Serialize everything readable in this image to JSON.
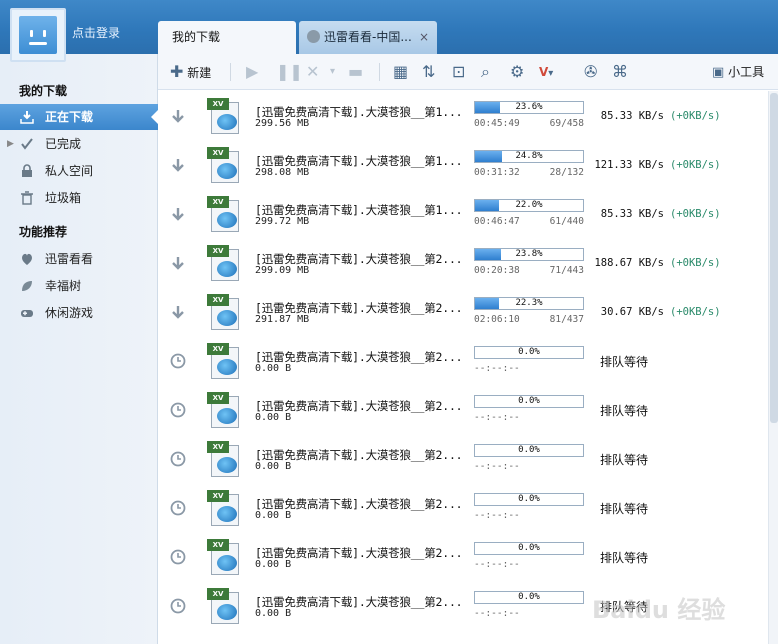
{
  "header": {
    "login_label": "点击登录",
    "tabs": [
      {
        "label": "我的下载",
        "active": true
      },
      {
        "label": "迅雷看看-中国...",
        "active": false,
        "close": "×"
      }
    ]
  },
  "toolbar": {
    "new_label": "新建",
    "tools_label": "小工具"
  },
  "sidebar": {
    "section_downloads": "我的下载",
    "items": [
      {
        "label": "正在下载",
        "icon": "download-icon",
        "selected": true
      },
      {
        "label": "已完成",
        "icon": "checkmark-icon",
        "selected": false
      },
      {
        "label": "私人空间",
        "icon": "lock-icon",
        "selected": false
      },
      {
        "label": "垃圾箱",
        "icon": "trash-icon",
        "selected": false
      }
    ],
    "section_features": "功能推荐",
    "features": [
      {
        "label": "迅雷看看",
        "icon": "xunlei-kankan-icon"
      },
      {
        "label": "幸福树",
        "icon": "leaf-icon"
      },
      {
        "label": "休闲游戏",
        "icon": "gamepad-icon"
      }
    ]
  },
  "downloads": [
    {
      "state": "downloading",
      "name": "[迅雷免费高清下载].大漠苍狼__第1...",
      "size": "299.56 MB",
      "progress": 23.6,
      "progress_label": "23.6%",
      "time": "00:45:49",
      "pieces": "69/458",
      "speed": "85.33 KB/s",
      "upload": "(+0KB/s)"
    },
    {
      "state": "downloading",
      "name": "[迅雷免费高清下载].大漠苍狼__第1...",
      "size": "298.08 MB",
      "progress": 24.8,
      "progress_label": "24.8%",
      "time": "00:31:32",
      "pieces": "28/132",
      "speed": "121.33 KB/s",
      "upload": "(+0KB/s)"
    },
    {
      "state": "downloading",
      "name": "[迅雷免费高清下载].大漠苍狼__第1...",
      "size": "299.72 MB",
      "progress": 22.0,
      "progress_label": "22.0%",
      "time": "00:46:47",
      "pieces": "61/440",
      "speed": "85.33 KB/s",
      "upload": "(+0KB/s)"
    },
    {
      "state": "downloading",
      "name": "[迅雷免费高清下载].大漠苍狼__第2...",
      "size": "299.09 MB",
      "progress": 23.8,
      "progress_label": "23.8%",
      "time": "00:20:38",
      "pieces": "71/443",
      "speed": "188.67 KB/s",
      "upload": "(+0KB/s)"
    },
    {
      "state": "downloading",
      "name": "[迅雷免费高清下载].大漠苍狼__第2...",
      "size": "291.87 MB",
      "progress": 22.3,
      "progress_label": "22.3%",
      "time": "02:06:10",
      "pieces": "81/437",
      "speed": "30.67 KB/s",
      "upload": "(+0KB/s)"
    },
    {
      "state": "queued",
      "name": "[迅雷免费高清下载].大漠苍狼__第2...",
      "size": "0.00 B",
      "progress": 0,
      "progress_label": "0.0%",
      "time": "--:--:--",
      "status": "排队等待"
    },
    {
      "state": "queued",
      "name": "[迅雷免费高清下载].大漠苍狼__第2...",
      "size": "0.00 B",
      "progress": 0,
      "progress_label": "0.0%",
      "time": "--:--:--",
      "status": "排队等待"
    },
    {
      "state": "queued",
      "name": "[迅雷免费高清下载].大漠苍狼__第2...",
      "size": "0.00 B",
      "progress": 0,
      "progress_label": "0.0%",
      "time": "--:--:--",
      "status": "排队等待"
    },
    {
      "state": "queued",
      "name": "[迅雷免费高清下载].大漠苍狼__第2...",
      "size": "0.00 B",
      "progress": 0,
      "progress_label": "0.0%",
      "time": "--:--:--",
      "status": "排队等待"
    },
    {
      "state": "queued",
      "name": "[迅雷免费高清下载].大漠苍狼__第2...",
      "size": "0.00 B",
      "progress": 0,
      "progress_label": "0.0%",
      "time": "--:--:--",
      "status": "排队等待"
    },
    {
      "state": "queued",
      "name": "[迅雷免费高清下载].大漠苍狼__第2...",
      "size": "0.00 B",
      "progress": 0,
      "progress_label": "0.0%",
      "time": "--:--:--",
      "status": "排队等待"
    }
  ],
  "file_badge": "XV",
  "watermark": "Baidu 经验",
  "colors": {
    "accent": "#3b86cc",
    "progress": "#2f7fcf",
    "upload_text": "#2a8a6a"
  }
}
